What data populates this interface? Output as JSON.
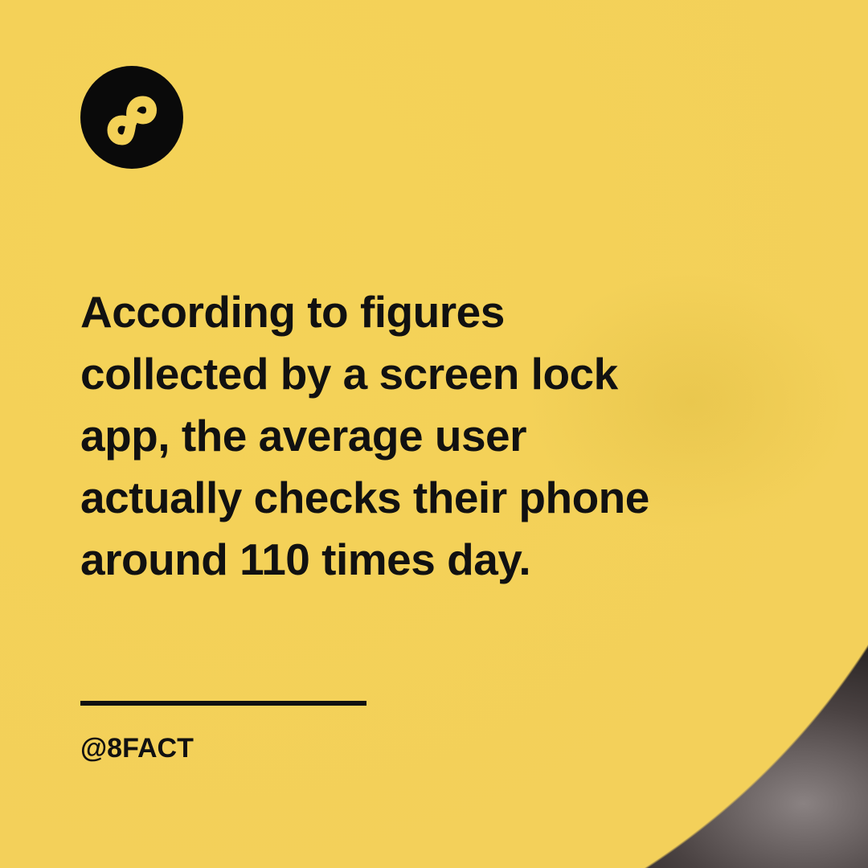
{
  "brand": {
    "logo": "infinity-8-logo",
    "handle": "@8FACT"
  },
  "fact": {
    "text": "According to figures collected by a screen lock app, the average user actually checks their phone around 110 times day.",
    "lines": [
      "According to figures",
      "collected by a screen lock",
      "app, the average user",
      "actually checks their phone",
      "around 110 times day."
    ]
  },
  "colors": {
    "accent": "#f3d157",
    "text": "#111111"
  }
}
